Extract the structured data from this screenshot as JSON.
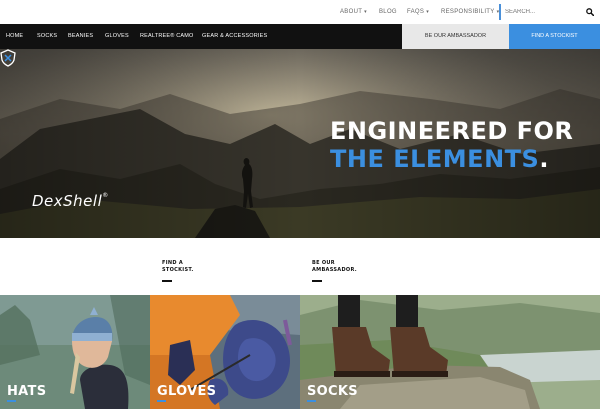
{
  "util_nav": {
    "about": "ABOUT",
    "blog": "BLOG",
    "faqs": "FAQS",
    "responsibility": "RESPONSIBILITY",
    "caret": "▾"
  },
  "search": {
    "placeholder": "SEARCH..."
  },
  "main_nav": {
    "items": [
      "HOME",
      "SOCKS",
      "BEANIES",
      "GLOVES",
      "REALTREE® CAMO",
      "GEAR & ACCESSORIES"
    ],
    "ambassador": "BE OUR AMBASSADOR",
    "stockist": "FIND A STOCKIST"
  },
  "hero": {
    "title_line1": "ENGINEERED FOR",
    "title_line2": "THE ELEMENTS",
    "title_dot": ".",
    "logo_text": "DexShell",
    "logo_reg": "®"
  },
  "cta": {
    "stockist_line1": "FIND A",
    "stockist_line2": "STOCKIST.",
    "ambassador_line1": "BE OUR",
    "ambassador_line2": "AMBASSADOR."
  },
  "categories": [
    {
      "label": "HATS"
    },
    {
      "label": "GLOVES"
    },
    {
      "label": "SOCKS"
    }
  ],
  "colors": {
    "accent": "#3b8fe0",
    "nav_bg": "#111111",
    "util_text": "#666666"
  },
  "icons": [
    "caret-down-icon",
    "search-icon",
    "dexshell-shield-icon"
  ]
}
